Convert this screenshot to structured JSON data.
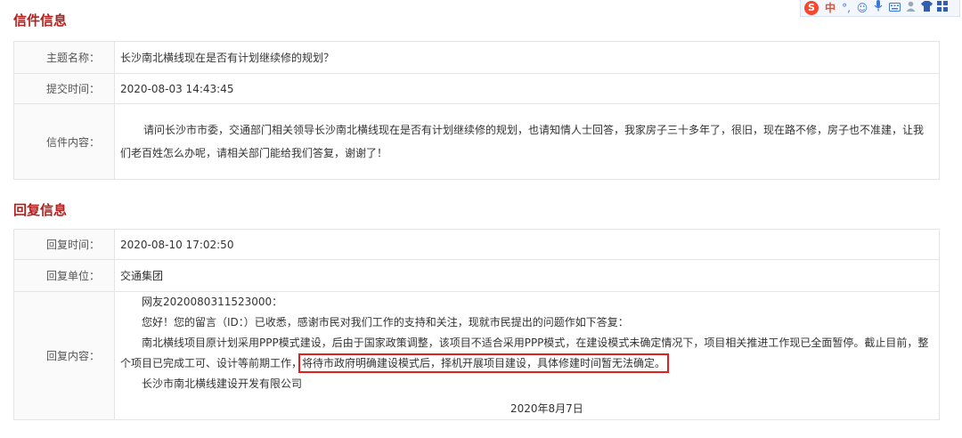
{
  "ime_toolbar": {
    "logo_glyph": "S",
    "mode_label": "中",
    "icons": [
      "punctuation-icon",
      "emoji-icon",
      "microphone-icon",
      "keyboard-icon",
      "user-icon",
      "skin-icon",
      "toolbox-icon"
    ]
  },
  "letter": {
    "section_title": "信件信息",
    "subject_label": "主题名称：",
    "subject_value": "长沙南北横线现在是否有计划继续修的规划？",
    "submit_time_label": "提交时间：",
    "submit_time_value": "2020-08-03 14:43:45",
    "content_label": "信件内容：",
    "content_value": "请问长沙市市委，交通部门相关领导长沙南北横线现在是否有计划继续修的规划，也请知情人士回答，我家房子三十多年了，很旧，现在路不修，房子也不准建，让我们老百姓怎么办呢，请相关部门能给我们答复，谢谢了！"
  },
  "reply": {
    "section_title": "回复信息",
    "reply_time_label": "回复时间：",
    "reply_time_value": "2020-08-10 17:02:50",
    "reply_unit_label": "回复单位：",
    "reply_unit_value": "交通集团",
    "content_label": "回复内容：",
    "greeting": "网友2020080311523000：",
    "intro": "您好！您的留言（ID：）已收悉，感谢市民对我们工作的支持和关注，现就市民提出的问题作如下答复：",
    "body_main": "南北横线项目原计划采用PPP模式建设，后由于国家政策调整，该项目不适合采用PPP模式，在建设模式未确定情况下，项目相关推进工作现已全面暂停。截止目前，整个项目已完成工可、设计等前期工作，",
    "body_highlight": "将待市政府明确建设模式后，择机开展项目建设，具体修建时间暂无法确定。",
    "signer": "长沙市南北横线建设开发有限公司",
    "sign_date": "2020年8月7日"
  }
}
